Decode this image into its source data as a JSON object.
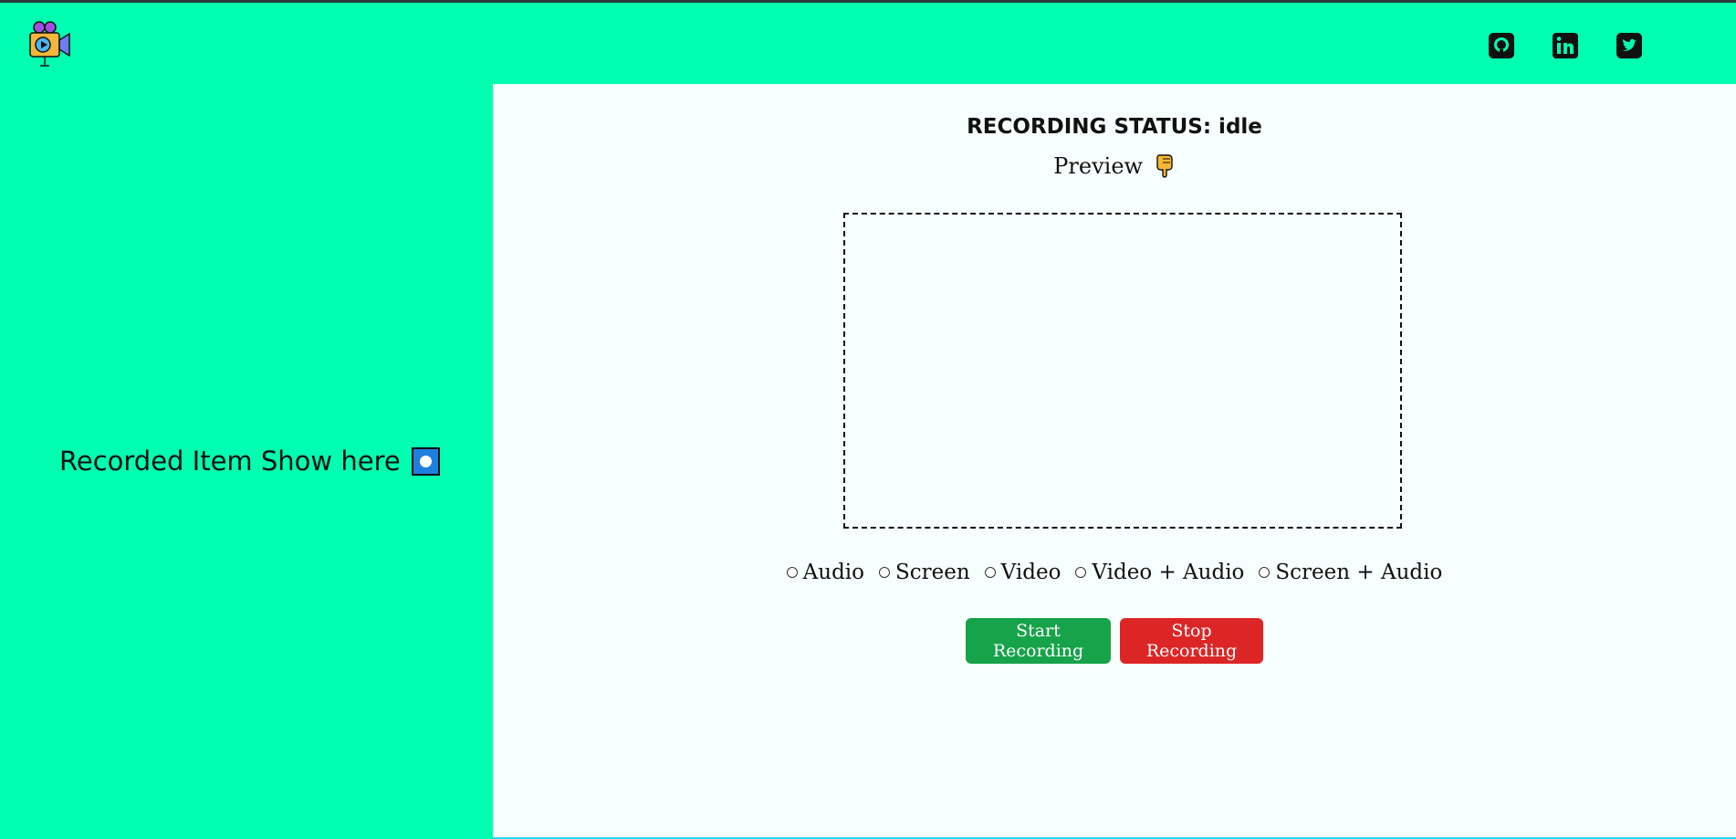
{
  "header": {
    "logo_icon": "video-camera-logo-icon",
    "social_links": [
      {
        "name": "github",
        "icon": "github-icon"
      },
      {
        "name": "linkedin",
        "icon": "linkedin-icon"
      },
      {
        "name": "twitter",
        "icon": "twitter-icon"
      }
    ]
  },
  "sidebar": {
    "title": "Recorded Item Show here",
    "icon": "record-button-icon"
  },
  "main": {
    "status_text": "RECORDING STATUS: idle",
    "preview_label": "Preview",
    "preview_icon": "backhand-index-pointing-down-icon",
    "options": [
      {
        "label": "Audio",
        "selected": false
      },
      {
        "label": "Screen",
        "selected": false
      },
      {
        "label": "Video",
        "selected": false
      },
      {
        "label": "Video + Audio",
        "selected": false
      },
      {
        "label": "Screen + Audio",
        "selected": false
      }
    ],
    "start_label": "Start Recording",
    "stop_label": "Stop Recording"
  },
  "colors": {
    "accent": "#00ffb0",
    "main_bg": "#f7fefe",
    "start": "#16a34a",
    "stop": "#dc2626"
  }
}
